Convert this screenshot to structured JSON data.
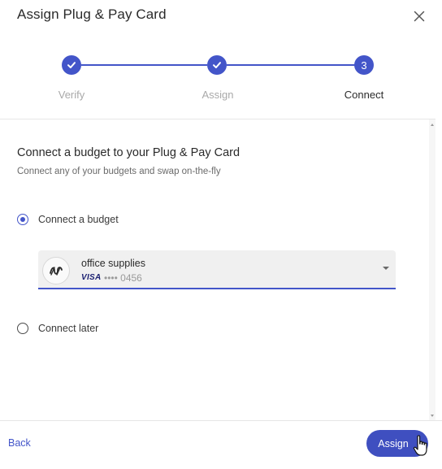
{
  "dialog": {
    "title": "Assign Plug & Pay Card",
    "close_icon": "close-icon"
  },
  "stepper": {
    "steps": [
      {
        "label": "Verify",
        "state": "completed",
        "icon": "checkmark-icon"
      },
      {
        "label": "Assign",
        "state": "completed",
        "icon": "checkmark-icon"
      },
      {
        "label": "Connect",
        "state": "active",
        "number": "3"
      }
    ]
  },
  "content": {
    "heading": "Connect a budget to your Plug & Pay Card",
    "subheading": "Connect any of your budgets and swap on-the-fly",
    "options": [
      {
        "label": "Connect a budget",
        "selected": true
      },
      {
        "label": "Connect later",
        "selected": false
      }
    ],
    "budget": {
      "name": "office supplies",
      "card_brand": "VISA",
      "card_masked": "•••• 0456",
      "avatar_icon": "budget-logo-icon"
    }
  },
  "footer": {
    "back_label": "Back",
    "assign_label": "Assign"
  },
  "colors": {
    "accent": "#4355c9",
    "button": "#3f4fc0",
    "muted": "#a9a9a9"
  }
}
